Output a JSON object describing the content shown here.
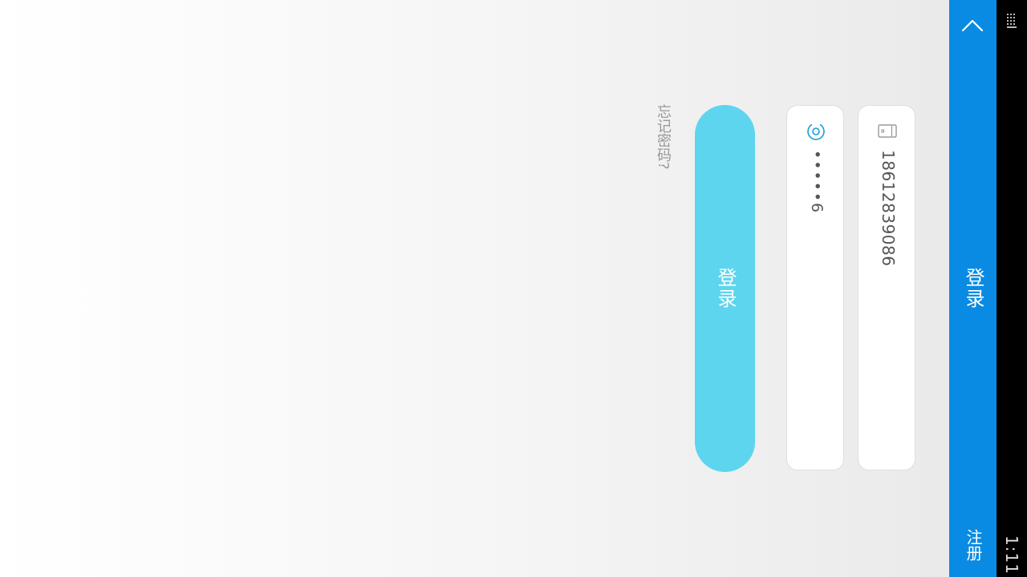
{
  "status_bar": {
    "time": "1:11",
    "keyboard_icon": "keyboard-icon"
  },
  "app_bar": {
    "title": "登录",
    "register_label": "注册",
    "collapse_icon": "chevron-up-icon",
    "color": "#0a8be3"
  },
  "form": {
    "phone": {
      "icon": "phone-icon",
      "value": "18612839086"
    },
    "password": {
      "icon": "at-icon",
      "value": "•••••6"
    },
    "login_button_label": "登录",
    "login_button_color": "#5ed5ee",
    "forgot_password_label": "忘记密码?"
  }
}
